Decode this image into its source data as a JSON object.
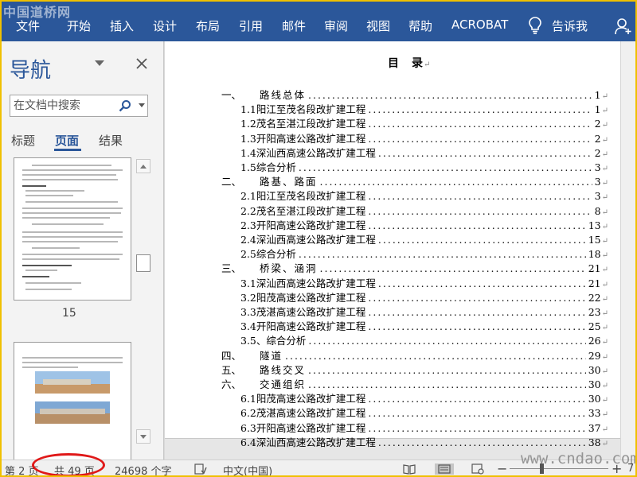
{
  "watermark_top": "中国道桥网",
  "watermark_bottom": "www.cndao.com",
  "ribbon": {
    "tabs": [
      "文件",
      "开始",
      "插入",
      "设计",
      "布局",
      "引用",
      "邮件",
      "审阅",
      "视图",
      "帮助",
      "ACROBAT"
    ],
    "tell_me": "告诉我",
    "color": "#2b579a"
  },
  "nav_pane": {
    "title": "导航",
    "search_placeholder": "在文档中搜索",
    "tabs": [
      "标题",
      "页面",
      "结果"
    ],
    "active_tab": "页面",
    "thumbnail_page_number": "15"
  },
  "document": {
    "toc_title": "目　录",
    "toc": [
      {
        "num": "一、",
        "text": "路线总体",
        "page": "1"
      },
      {
        "num": "1.1",
        "text": "阳江至茂名段改扩建工程",
        "page": "1"
      },
      {
        "num": "1.2",
        "text": "茂名至湛江段改扩建工程",
        "page": "2"
      },
      {
        "num": "1.3",
        "text": "开阳高速公路改扩建工程",
        "page": "2"
      },
      {
        "num": "1.4",
        "text": "深汕西高速公路改扩建工程",
        "page": "2"
      },
      {
        "num": "1.5",
        "text": "综合分析",
        "page": "3"
      },
      {
        "num": "二、",
        "text": "路基、路面",
        "page": "3"
      },
      {
        "num": "2.1",
        "text": "阳江至茂名段改扩建工程",
        "page": "3"
      },
      {
        "num": "2.2",
        "text": "茂名至湛江段改扩建工程",
        "page": "8"
      },
      {
        "num": "2.3",
        "text": "开阳高速公路改扩建工程",
        "page": "13"
      },
      {
        "num": "2.4",
        "text": "深汕西高速公路改扩建工程",
        "page": "15"
      },
      {
        "num": "2.5",
        "text": "综合分析",
        "page": "18"
      },
      {
        "num": "三、",
        "text": "桥梁、涵洞",
        "page": "21"
      },
      {
        "num": "3.1",
        "text": "深汕西高速公路改扩建工程",
        "page": "21"
      },
      {
        "num": "3.2",
        "text": "阳茂高速公路改扩建工程",
        "page": "22"
      },
      {
        "num": "3.3",
        "text": "茂湛高速公路改扩建工程",
        "page": "23"
      },
      {
        "num": "3.4",
        "text": "开阳高速公路改扩建工程",
        "page": "25"
      },
      {
        "num": "3.5、",
        "text": "综合分析",
        "page": "26"
      },
      {
        "num": "四、",
        "text": "隧道",
        "page": "29"
      },
      {
        "num": "五、",
        "text": "路线交叉",
        "page": "30"
      },
      {
        "num": "六、",
        "text": "交通组织",
        "page": "30"
      },
      {
        "num": "6.1",
        "text": "阳茂高速公路改扩建工程",
        "page": "30"
      },
      {
        "num": "6.2",
        "text": "茂湛高速公路改扩建工程",
        "page": "33"
      },
      {
        "num": "6.3",
        "text": "开阳高速公路改扩建工程",
        "page": "37"
      },
      {
        "num": "6.4",
        "text": "深汕西高速公路改扩建工程",
        "page": "38"
      }
    ]
  },
  "status_bar": {
    "page": "第 2 页",
    "total": "共 49 页",
    "words": "24698 个字",
    "language": "中文(中国)",
    "zoom_minus": "−",
    "zoom_plus": "+",
    "zoom_level_partial": "7"
  },
  "colors": {
    "accent": "#2b579a",
    "highlight_circle": "#e01919",
    "frame": "#f0c000"
  }
}
